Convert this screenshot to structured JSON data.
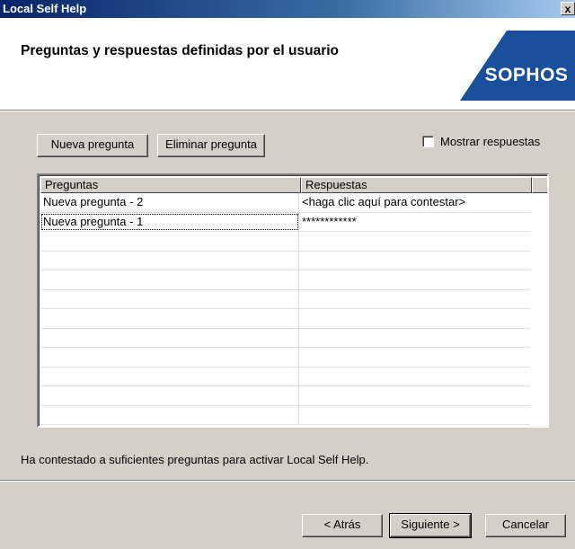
{
  "window": {
    "title": "Local Self Help",
    "close_glyph": "✕"
  },
  "header": {
    "heading": "Preguntas y respuestas definidas por el usuario",
    "logo_text": "SOPHOS",
    "logo_color": "#1a4f9c"
  },
  "toolbar": {
    "new_question_label": "Nueva pregunta",
    "delete_question_label": "Eliminar pregunta",
    "show_answers_label": "Mostrar respuestas",
    "show_answers_checked": false
  },
  "table": {
    "columns": [
      "Preguntas",
      "Respuestas"
    ],
    "rows": [
      {
        "question": "Nueva pregunta - 2",
        "answer": "<haga clic aquí para contestar>"
      },
      {
        "question": "Nueva pregunta - 1",
        "answer": "************"
      }
    ],
    "empty_row_count": 10
  },
  "status_message": "Ha contestado a suficientes preguntas para activar Local Self Help.",
  "footer": {
    "back_label": "< Atrás",
    "next_label": "Siguiente >",
    "cancel_label": "Cancelar"
  }
}
